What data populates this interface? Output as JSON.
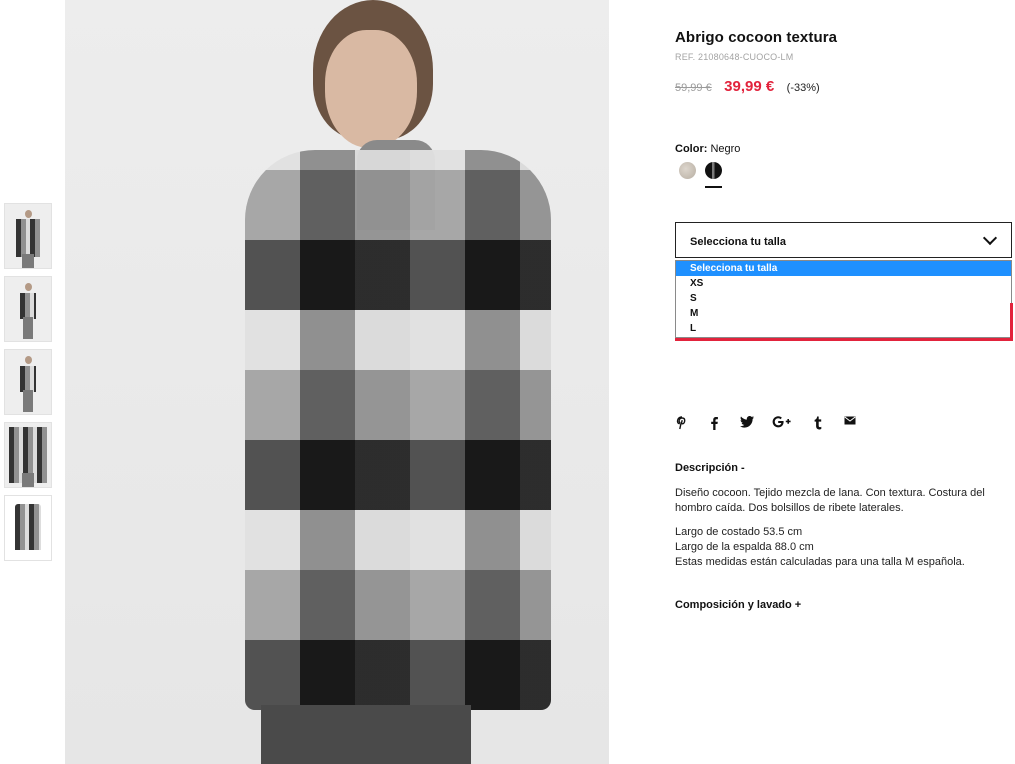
{
  "product": {
    "title": "Abrigo cocoon textura",
    "ref": "REF. 21080648-CUOCO-LM",
    "old_price": "59,99 €",
    "new_price": "39,99 €",
    "discount": "(-33%)",
    "price_color": "#e2233c"
  },
  "color": {
    "label": "Color:",
    "value": "Negro",
    "swatches": [
      "beige",
      "black"
    ],
    "selected": "black"
  },
  "size": {
    "select_label": "Selecciona tu talla",
    "options": [
      "Selecciona tu talla",
      "XS",
      "S",
      "M",
      "L"
    ],
    "highlighted": "Selecciona tu talla"
  },
  "social": [
    "pinterest-icon",
    "facebook-icon",
    "twitter-icon",
    "google-plus-icon",
    "tumblr-icon",
    "email-icon"
  ],
  "description": {
    "heading": "Descripción -",
    "paragraph1": "Diseño cocoon. Tejido mezcla de lana. Con textura. Costura del hombro caída. Dos bolsillos de ribete laterales.",
    "line1": "Largo de costado 53.5 cm",
    "line2": "Largo de la espalda 88.0 cm",
    "line3": "Estas medidas están calculadas para una talla M española."
  },
  "composition": {
    "heading": "Composición y lavado +"
  }
}
